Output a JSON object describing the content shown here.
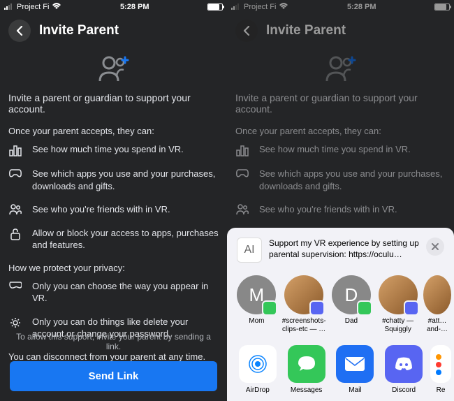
{
  "status": {
    "carrier": "Project Fi",
    "time": "5:28 PM"
  },
  "header": {
    "title": "Invite Parent"
  },
  "subtitle": "Invite a parent or guardian to support your account.",
  "accepts_label": "Once your parent accepts, they can:",
  "features_can": [
    "See how much time you spend in VR.",
    "See which apps you use and your purchases, downloads and gifts.",
    "See who you're friends with in VR.",
    "Allow or block your access to apps, purchases and features."
  ],
  "privacy_label": "How we protect your privacy:",
  "features_privacy": [
    "Only you can choose the way you appear in VR.",
    "Only you can do things like delete your account or change your password."
  ],
  "disconnect_note": "You can disconnect from your parent at any time.",
  "footer_note": "To allow this support, invite your parent by sending a link.",
  "send_button": "Send Link",
  "share": {
    "thumb_label": "AI",
    "message": "Support my VR experience by setting up parental supervision: https://oculu…",
    "contacts": [
      {
        "initial": "M",
        "label": "Mom",
        "badge": "green",
        "avatar": "letter"
      },
      {
        "initial": "",
        "label": "#screenshots-clips-etc — …",
        "badge": "discord",
        "avatar": "dog"
      },
      {
        "initial": "D",
        "label": "Dad",
        "badge": "green",
        "avatar": "letter"
      },
      {
        "initial": "",
        "label": "#chatty — Squiggly Time",
        "badge": "discord",
        "avatar": "dog"
      },
      {
        "initial": "",
        "label": "#att… and-…",
        "badge": "discord",
        "avatar": "dog"
      }
    ],
    "apps": [
      {
        "label": "AirDrop",
        "key": "airdrop"
      },
      {
        "label": "Messages",
        "key": "messages"
      },
      {
        "label": "Mail",
        "key": "mail"
      },
      {
        "label": "Discord",
        "key": "discord"
      },
      {
        "label": "Re",
        "key": "reminders"
      }
    ]
  }
}
